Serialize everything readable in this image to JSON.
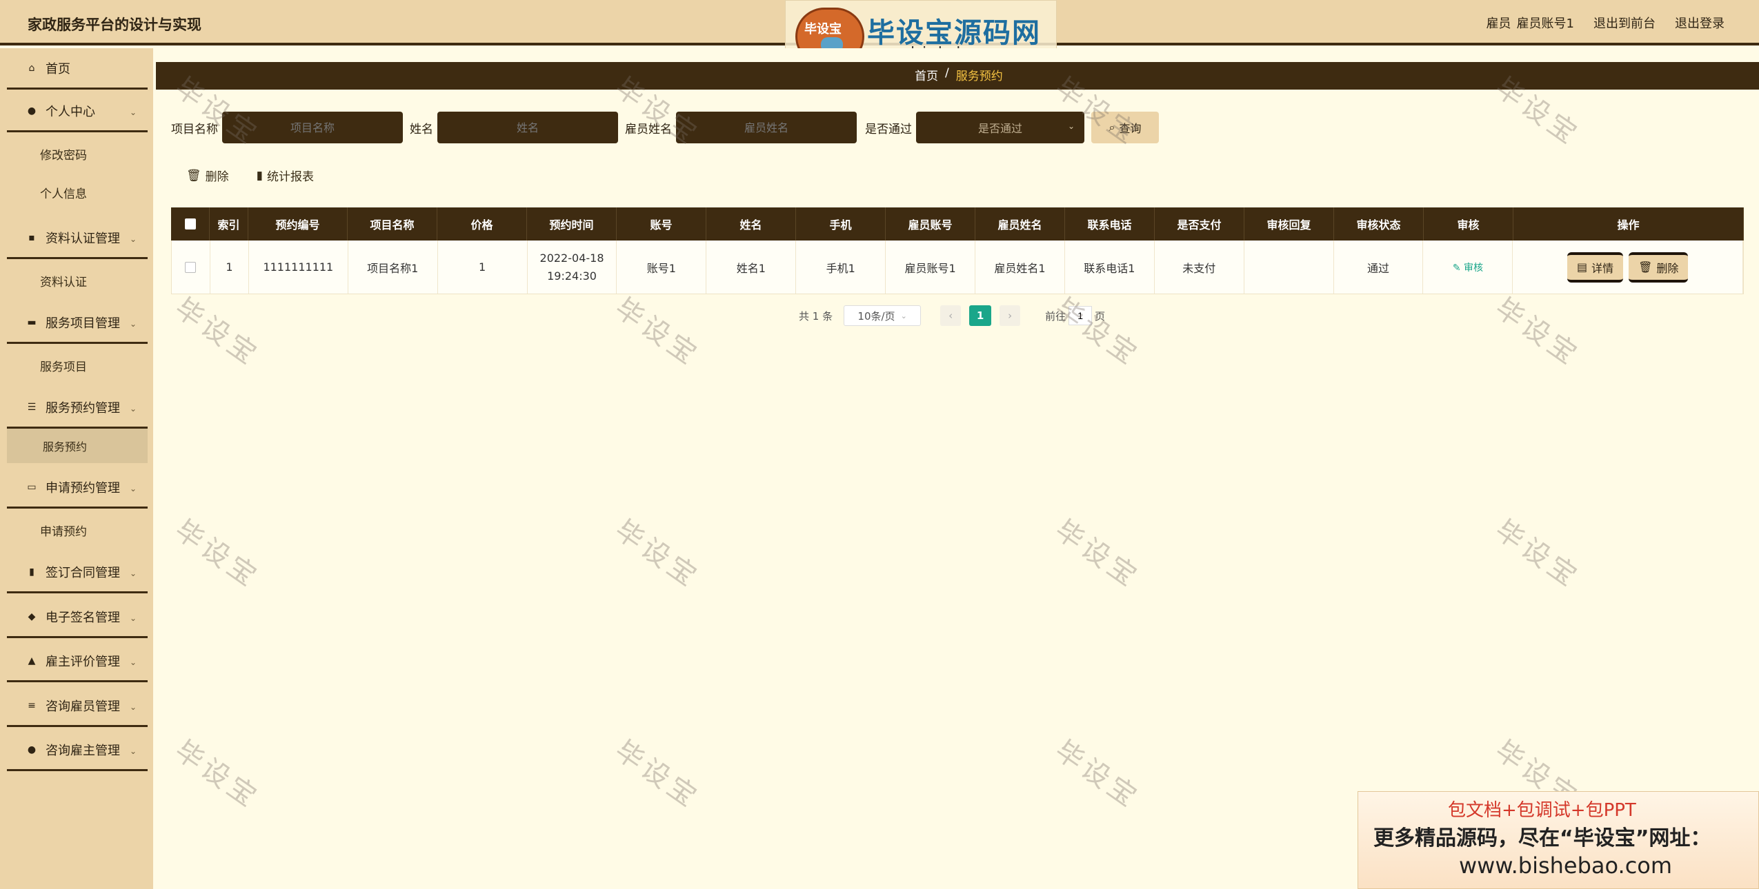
{
  "header": {
    "title": "家政服务平台的设计与实现",
    "role": "雇员",
    "account": "雇员账号1",
    "to_front": "退出到前台",
    "logout": "退出登录"
  },
  "watermark_logo": {
    "seal_text": "毕设宝",
    "title": "毕设宝源码网",
    "url": "www.bishebao.com"
  },
  "watermark_text": "毕设宝",
  "sidebar": {
    "home": "首页",
    "personal": "个人中心",
    "change_pwd": "修改密码",
    "profile": "个人信息",
    "cert_mgmt": "资料认证管理",
    "cert": "资料认证",
    "svc_item_mgmt": "服务项目管理",
    "svc_item": "服务项目",
    "svc_booking_mgmt": "服务预约管理",
    "svc_booking": "服务预约",
    "apply_mgmt": "申请预约管理",
    "apply": "申请预约",
    "contract_mgmt": "签订合同管理",
    "esign_mgmt": "电子签名管理",
    "review_mgmt": "雇主评价管理",
    "consult_emp_mgmt": "咨询雇员管理",
    "consult_boss_mgmt": "咨询雇主管理"
  },
  "breadcrumb": {
    "home": "首页",
    "sep": "/",
    "current": "服务预约"
  },
  "search": {
    "project_label": "项目名称",
    "project_placeholder": "项目名称",
    "name_label": "姓名",
    "name_placeholder": "姓名",
    "emp_name_label": "雇员姓名",
    "emp_name_placeholder": "雇员姓名",
    "passed_label": "是否通过",
    "passed_placeholder": "是否通过",
    "query": "查询"
  },
  "actions": {
    "delete": "删除",
    "report": "统计报表"
  },
  "table": {
    "headers": [
      "索引",
      "预约编号",
      "项目名称",
      "价格",
      "预约时间",
      "账号",
      "姓名",
      "手机",
      "雇员账号",
      "雇员姓名",
      "联系电话",
      "是否支付",
      "审核回复",
      "审核状态",
      "审核",
      "操作"
    ],
    "rows": [
      {
        "index": "1",
        "booking_no": "1111111111",
        "project": "项目名称1",
        "price": "1",
        "time": "2022-04-18 19:24:30",
        "account": "账号1",
        "name": "姓名1",
        "phone": "手机1",
        "emp_account": "雇员账号1",
        "emp_name": "雇员姓名1",
        "contact": "联系电话1",
        "paid": "未支付",
        "reply": "",
        "status": "通过",
        "audit": "审核",
        "detail_btn": "详情",
        "delete_btn": "删除"
      }
    ]
  },
  "pager": {
    "total": "共 1 条",
    "page_size": "10条/页",
    "current": "1",
    "goto_prefix": "前往",
    "goto_value": "1",
    "goto_suffix": "页"
  },
  "ad": {
    "line1": "包文档+包调试+包PPT",
    "line2": "更多精品源码，尽在“毕设宝”网址：",
    "line3": "www.bishebao.com"
  }
}
